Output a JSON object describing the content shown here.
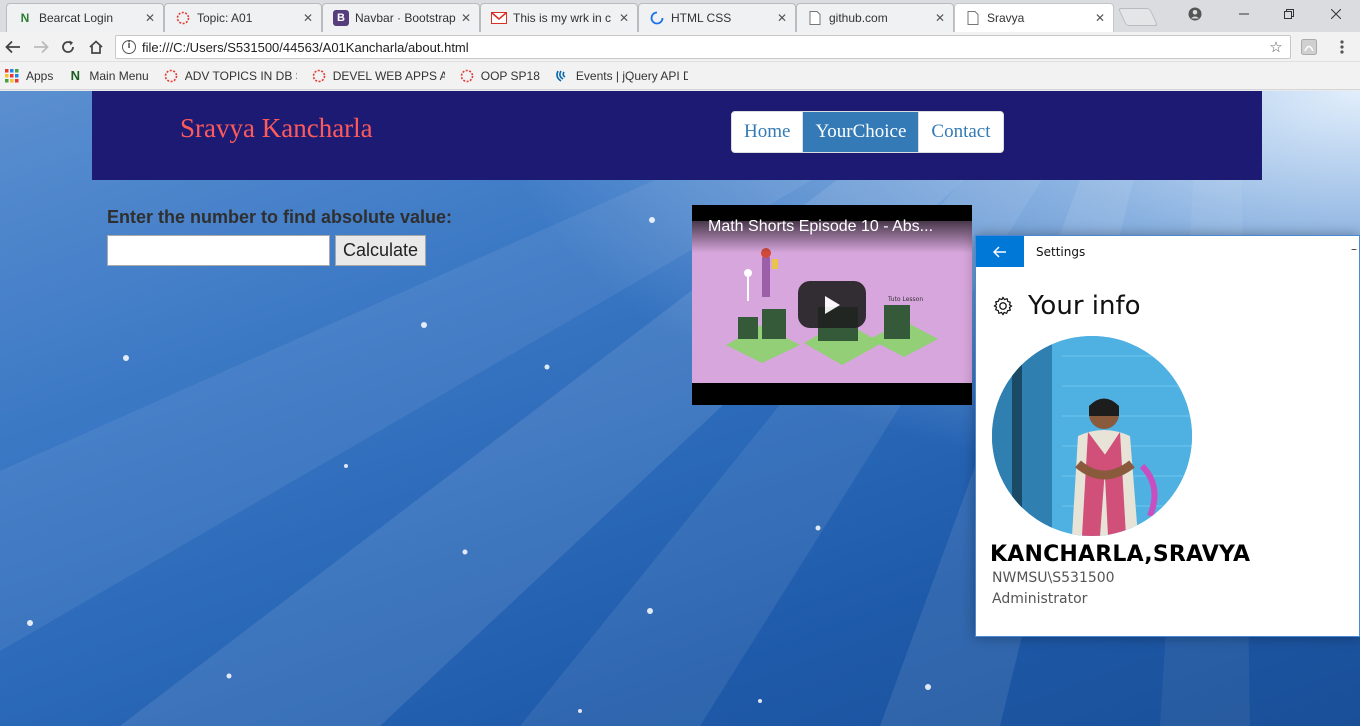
{
  "browser": {
    "tabs": [
      {
        "title": "Bearcat Login",
        "icon": "northwest-n-icon",
        "color": "#2e7d32"
      },
      {
        "title": "Topic: A01",
        "icon": "loading-ring-icon",
        "color": "#e53935"
      },
      {
        "title": "Navbar · Bootstrap",
        "icon": "bootstrap-b-icon",
        "color": "#563d7c"
      },
      {
        "title": "This is my wrk in c",
        "icon": "gmail-icon",
        "color": "#d93025"
      },
      {
        "title": "HTML CSS",
        "icon": "loading-spinner-icon",
        "color": "#1a73e8"
      },
      {
        "title": "github.com",
        "icon": "page-icon",
        "color": "#888888"
      },
      {
        "title": "Sravya",
        "icon": "page-icon",
        "color": "#888888"
      }
    ],
    "active_tab": "Sravya",
    "address": "file:///C:/Users/S531500/44563/A01Kancharla/about.html",
    "bookmarks": [
      {
        "label": "Apps",
        "icon": "apps-grid-icon"
      },
      {
        "label": "Main Menu",
        "icon": "northwest-n-icon"
      },
      {
        "label": "ADV TOPICS IN DB SY",
        "icon": "loading-ring-icon"
      },
      {
        "label": "DEVEL WEB APPS AN",
        "icon": "loading-ring-icon"
      },
      {
        "label": "OOP SP18",
        "icon": "loading-ring-icon"
      },
      {
        "label": "Events | jQuery API D",
        "icon": "jquery-icon"
      }
    ]
  },
  "site": {
    "brand": "Sravya Kancharla",
    "nav": [
      {
        "label": "Home",
        "active": false
      },
      {
        "label": "YourChoice",
        "active": true
      },
      {
        "label": "Contact",
        "active": false
      }
    ],
    "form": {
      "prompt": "Enter the number to find absolute value:",
      "input_value": "",
      "button_label": "Calculate"
    },
    "video": {
      "title": "Math Shorts Episode 10 - Abs...",
      "thumbnail_caption": "Tuto Lesson"
    }
  },
  "settings_window": {
    "app_title": "Settings",
    "heading": "Your info",
    "display_name": "KANCHARLA,SRAVYA",
    "account": "NWMSU\\S531500",
    "role": "Administrator"
  },
  "colors": {
    "navbar_bg": "#1c1a72",
    "brand_text": "#ff5a5a",
    "nav_link": "#337ab7",
    "settings_accent": "#0078d7"
  }
}
